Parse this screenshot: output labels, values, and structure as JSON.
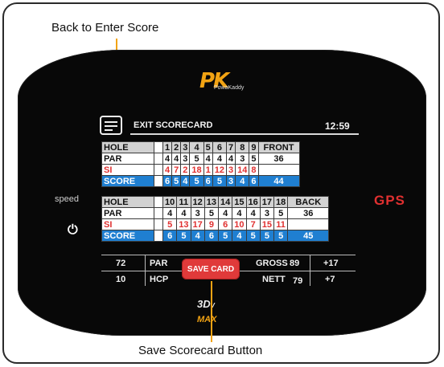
{
  "callouts": {
    "top": "Back to Enter Score",
    "bottom": "Save Scorecard Button"
  },
  "brand": {
    "logo": "PK",
    "name": "PowaKaddy",
    "model_top": "3D",
    "model_sub": "V",
    "model_bottom": "MAX"
  },
  "side": {
    "speed": "speed",
    "power_icon": "power-icon",
    "gps": "GPS"
  },
  "header": {
    "exit": "EXIT SCORECARD",
    "time": "12:59"
  },
  "front_nine": {
    "labels": [
      "HOLE",
      "PAR",
      "SI",
      "SCORE"
    ],
    "holes": [
      "1",
      "2",
      "3",
      "4",
      "5",
      "6",
      "7",
      "8",
      "9"
    ],
    "par": [
      "4",
      "4",
      "3",
      "5",
      "4",
      "4",
      "4",
      "3",
      "5"
    ],
    "si": [
      "4",
      "7",
      "2",
      "18",
      "1",
      "12",
      "3",
      "14",
      "8"
    ],
    "score": [
      "6",
      "5",
      "4",
      "5",
      "6",
      "5",
      "3",
      "4",
      "6"
    ],
    "total_label": "FRONT",
    "total_par": "36",
    "total_score": "44"
  },
  "back_nine": {
    "labels": [
      "HOLE",
      "PAR",
      "SI",
      "SCORE"
    ],
    "holes": [
      "10",
      "11",
      "12",
      "13",
      "14",
      "15",
      "16",
      "17",
      "18"
    ],
    "par": [
      "4",
      "4",
      "3",
      "5",
      "4",
      "4",
      "4",
      "3",
      "5"
    ],
    "si": [
      "5",
      "13",
      "17",
      "9",
      "6",
      "10",
      "7",
      "15",
      "11"
    ],
    "score": [
      "6",
      "5",
      "4",
      "6",
      "5",
      "4",
      "5",
      "5",
      "5"
    ],
    "total_label": "BACK",
    "total_par": "36",
    "total_score": "45"
  },
  "totals": {
    "par_value": "72",
    "par_label": "PAR",
    "hcp_value": "10",
    "hcp_label": "HCP",
    "gross_label": "GROSS",
    "gross_value": "89",
    "gross_diff": "+17",
    "nett_label": "NETT",
    "nett_value": "79",
    "nett_diff": "+7"
  },
  "save_button": "SAVE CARD",
  "colors": {
    "accent": "#f2a313",
    "score_blue": "#1f7fd1",
    "si_red": "#e03030",
    "button_red": "#e03a3a"
  }
}
